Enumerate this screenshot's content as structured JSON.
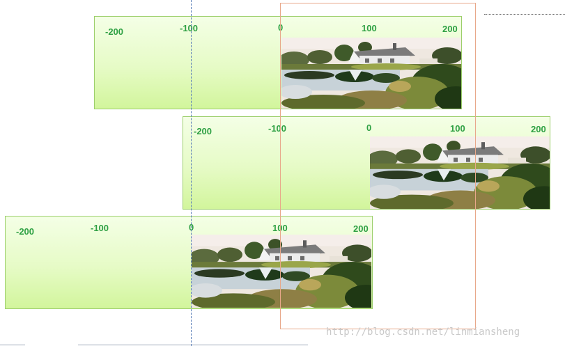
{
  "strips": [
    {
      "ticks": [
        "-200",
        "-100",
        "0",
        "100",
        "200"
      ]
    },
    {
      "ticks": [
        "-200",
        "-100",
        "0",
        "100",
        "200"
      ]
    },
    {
      "ticks": [
        "-200",
        "-100",
        "0",
        "100",
        "200"
      ]
    }
  ],
  "photo": {
    "subject": "country-house-by-pond-photo"
  },
  "watermark": "http://blog.csdn.net/linmiansheng",
  "colors": {
    "tick_text": "#2ea043",
    "strip_border": "#9ccf6b",
    "viewport_border": "#e8a88a",
    "origin_line": "#5b7fb8"
  }
}
